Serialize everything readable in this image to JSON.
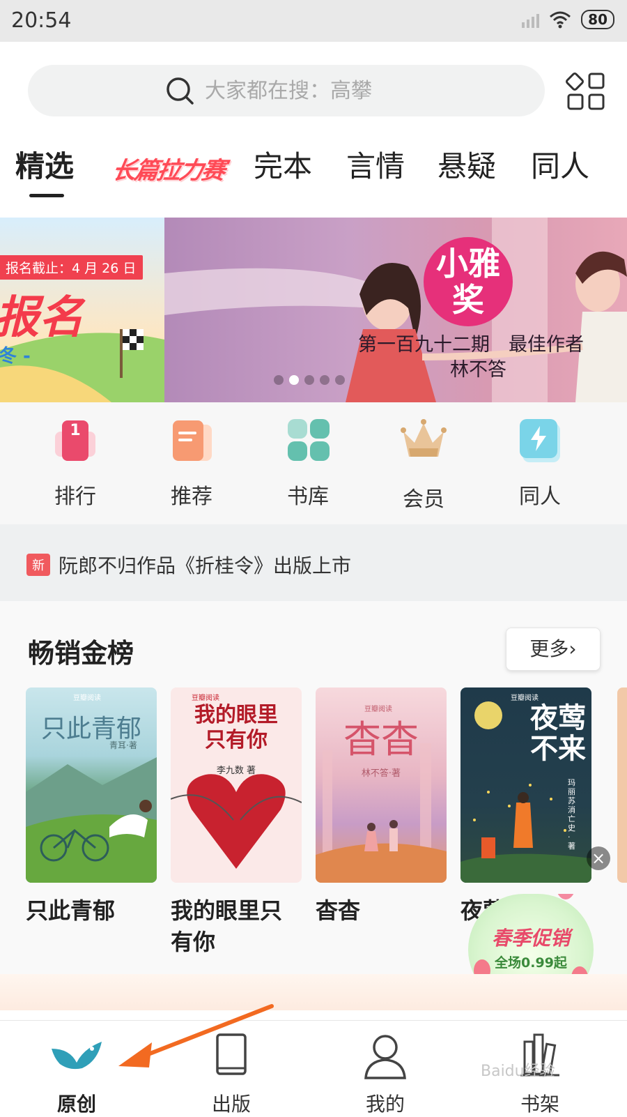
{
  "status_bar": {
    "time": "20:54",
    "battery": "80"
  },
  "search": {
    "placeholder": "大家都在搜：高攀"
  },
  "tabs": [
    {
      "label": "精选",
      "active": true
    },
    {
      "label": "长篇拉力赛",
      "promo": true
    },
    {
      "label": "完本"
    },
    {
      "label": "言情"
    },
    {
      "label": "悬疑"
    },
    {
      "label": "同人"
    }
  ],
  "banner": {
    "left": {
      "tag": "报名截止：4 月 26 日",
      "headline": "报名",
      "sub": "冬 -"
    },
    "main": {
      "award": "小雅奖",
      "line1": "第一百九十二期　最佳作者",
      "line2": "林不答"
    },
    "active_dot": 1
  },
  "quick_links": [
    {
      "label": "排行",
      "icon": "ranking-icon"
    },
    {
      "label": "推荐",
      "icon": "recommend-icon"
    },
    {
      "label": "书库",
      "icon": "library-icon"
    },
    {
      "label": "会员",
      "icon": "crown-icon"
    },
    {
      "label": "同人",
      "icon": "fanfic-icon"
    }
  ],
  "notice": {
    "badge": "新",
    "text": "阮郎不归作品《折桂令》出版上市"
  },
  "bestsellers": {
    "title": "畅销金榜",
    "more_label": "更多›",
    "books": [
      {
        "title": "只此青郁",
        "cover_title": "只此青郁",
        "author": "青耳·著",
        "publisher": "豆瓣阅读"
      },
      {
        "title": "我的眼里只有你",
        "cover_title": "我的眼里只有你",
        "author": "李九数 著",
        "publisher": "豆瓣阅读"
      },
      {
        "title": "杳杳",
        "cover_title": "杳杳",
        "author": "林不答·著",
        "publisher": "豆瓣阅读"
      },
      {
        "title": "夜莺不来",
        "cover_title": "夜莺不来",
        "author": "玛丽苏消亡史·著",
        "publisher": "豆瓣阅读"
      }
    ]
  },
  "promo": {
    "title": "春季促销",
    "subtitle": "全场0.99起"
  },
  "bottom_nav": [
    {
      "label": "原创",
      "active": true
    },
    {
      "label": "出版"
    },
    {
      "label": "我的"
    },
    {
      "label": "书架"
    }
  ],
  "watermark": "Baidu经验"
}
